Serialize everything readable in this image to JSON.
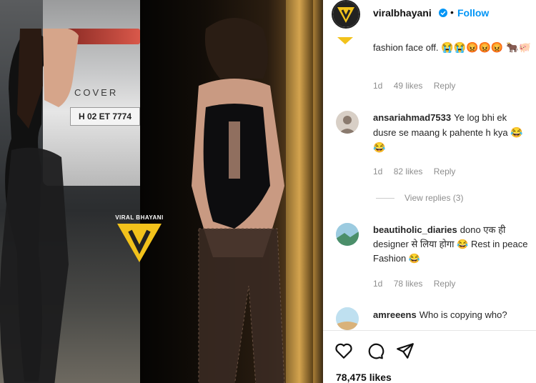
{
  "photo": {
    "car_brand": "COVER",
    "plate": "H 02 ET 7774",
    "watermark": "VIRAL BHAYANI"
  },
  "header": {
    "username": "viralbhayani",
    "separator": "•",
    "follow_label": "Follow"
  },
  "comments": [
    {
      "user": "",
      "text": "fashion face off.",
      "emojis": "😭😭😡😡😡 🐂🐖",
      "time": "1d",
      "likes": "49 likes",
      "reply": "Reply"
    },
    {
      "user": "ansariahmad7533",
      "text": "Ye log bhi ek dusre se maang k pahente h kya",
      "emojis": "😂😂",
      "time": "1d",
      "likes": "82 likes",
      "reply": "Reply"
    },
    {
      "user": "beautiholic_diaries",
      "text": "dono एक ही designer से लिया होगा 😂 Rest in peace Fashion 😂",
      "time": "1d",
      "likes": "78 likes",
      "reply": "Reply"
    },
    {
      "user": "amreeens",
      "text": "Who is copying who?"
    }
  ],
  "view_replies": "View replies (3)",
  "likes_total": "78,475 likes",
  "colors": {
    "follow": "#0095f6",
    "watermark_yellow": "#f2c21b"
  }
}
